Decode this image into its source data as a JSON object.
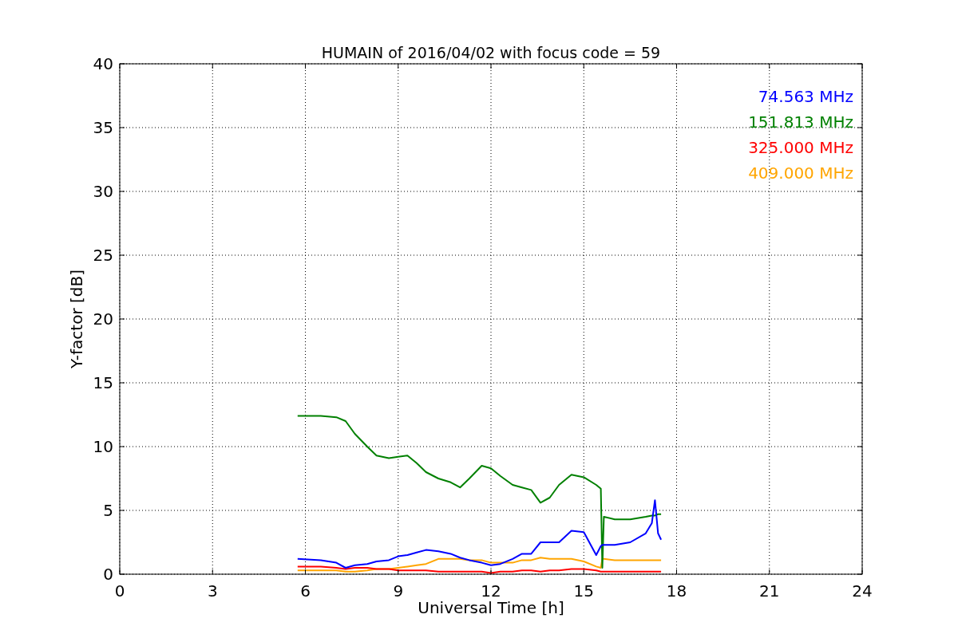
{
  "chart": {
    "chart_data": {
      "type": "line",
      "grid": true,
      "title": "HUMAIN of 2016/04/02 with focus code = 59",
      "xlabel": "Universal Time [h]",
      "ylabel": "Y-factor [dB]",
      "xlim": [
        0,
        24
      ],
      "ylim": [
        0,
        40
      ],
      "xticks": [
        0,
        3,
        6,
        9,
        12,
        15,
        18,
        21,
        24
      ],
      "yticks": [
        0,
        5,
        10,
        15,
        20,
        25,
        30,
        35,
        40
      ],
      "x": [
        5.75,
        6.5,
        7,
        7.3,
        7.6,
        8,
        8.3,
        8.7,
        9,
        9.3,
        9.6,
        9.9,
        10.3,
        10.7,
        11,
        11.3,
        11.7,
        12,
        12.3,
        12.7,
        13,
        13.3,
        13.6,
        13.9,
        14.2,
        14.6,
        15,
        15.4,
        15.55,
        15.6,
        15.65,
        16,
        16.5,
        17,
        17.2,
        17.3,
        17.4,
        17.5
      ],
      "series": [
        {
          "name": "74.563 MHz",
          "color": "#0000ff",
          "values": [
            1.2,
            1.1,
            0.9,
            0.5,
            0.7,
            0.8,
            1.0,
            1.1,
            1.4,
            1.5,
            1.7,
            1.9,
            1.8,
            1.6,
            1.3,
            1.1,
            0.9,
            0.7,
            0.8,
            1.2,
            1.6,
            1.6,
            2.5,
            2.5,
            2.5,
            3.4,
            3.3,
            1.5,
            2.2,
            2.3,
            2.3,
            2.3,
            2.5,
            3.2,
            4.0,
            5.8,
            3.2,
            2.7
          ]
        },
        {
          "name": "151.813 MHz",
          "color": "#008000",
          "values": [
            12.4,
            12.4,
            12.3,
            12.0,
            11.0,
            10.0,
            9.3,
            9.1,
            9.2,
            9.3,
            8.7,
            8.0,
            7.5,
            7.2,
            6.8,
            7.5,
            8.5,
            8.3,
            7.7,
            7.0,
            6.8,
            6.6,
            5.6,
            6.0,
            7.0,
            7.8,
            7.6,
            7.0,
            6.7,
            0.5,
            4.5,
            4.3,
            4.3,
            4.5,
            4.6,
            4.6,
            4.7,
            4.7
          ]
        },
        {
          "name": "325.000 MHz",
          "color": "#ff0000",
          "values": [
            0.6,
            0.6,
            0.5,
            0.4,
            0.5,
            0.5,
            0.4,
            0.4,
            0.3,
            0.3,
            0.3,
            0.3,
            0.2,
            0.2,
            0.2,
            0.2,
            0.2,
            0.1,
            0.2,
            0.2,
            0.3,
            0.3,
            0.2,
            0.3,
            0.3,
            0.4,
            0.4,
            0.3,
            0.2,
            0.2,
            0.2,
            0.2,
            0.2,
            0.2,
            0.2,
            0.2,
            0.2,
            0.2
          ]
        },
        {
          "name": "409.000 MHz",
          "color": "#ffa500",
          "values": [
            0.3,
            0.3,
            0.3,
            0.2,
            0.2,
            0.3,
            0.4,
            0.4,
            0.5,
            0.6,
            0.7,
            0.8,
            1.2,
            1.2,
            1.2,
            1.1,
            1.1,
            0.9,
            0.9,
            0.9,
            1.1,
            1.1,
            1.3,
            1.2,
            1.2,
            1.2,
            1.0,
            0.6,
            0.5,
            1.2,
            1.2,
            1.1,
            1.1,
            1.1,
            1.1,
            1.1,
            1.1,
            1.1
          ]
        }
      ]
    }
  }
}
